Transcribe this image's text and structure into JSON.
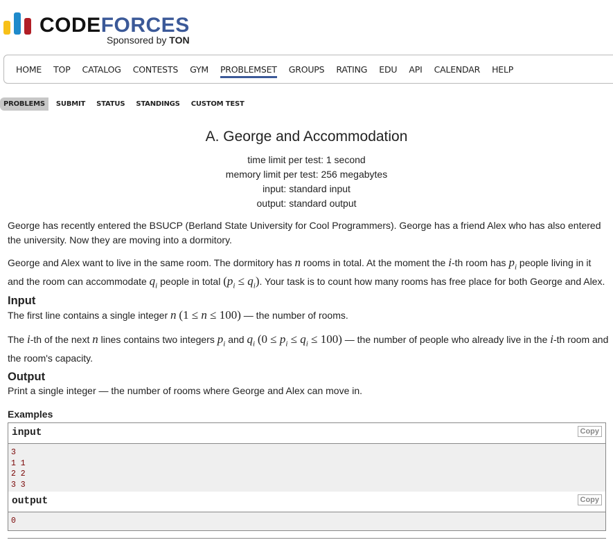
{
  "brand": {
    "code": "CODE",
    "forces": "FORCES",
    "sponsored_by": "Sponsored by",
    "sponsor": "TON",
    "colors": {
      "yellow": "#f7c018",
      "blue": "#1f8acb",
      "red": "#b11e26",
      "navy": "#3b5998"
    }
  },
  "main_menu": [
    "HOME",
    "TOP",
    "CATALOG",
    "CONTESTS",
    "GYM",
    "PROBLEMSET",
    "GROUPS",
    "RATING",
    "EDU",
    "API",
    "CALENDAR",
    "HELP"
  ],
  "sub_menu": [
    "PROBLEMS",
    "SUBMIT",
    "STATUS",
    "STANDINGS",
    "CUSTOM TEST"
  ],
  "problem": {
    "title": "A. George and Accommodation",
    "time_limit": "time limit per test: 1 second",
    "memory_limit": "memory limit per test: 256 megabytes",
    "input": "input: standard input",
    "output": "output: standard output"
  },
  "statement": {
    "p1": "George has recently entered the BSUCP (Berland State University for Cool Programmers). George has a friend Alex who has also entered the university. Now they are moving into a dormitory.",
    "p2_a": "George and Alex want to live in the same room. The dormitory has",
    "p2_b": "rooms in total. At the moment the",
    "p2_c": "-th room has",
    "p2_d": "people living in it and the room can accommodate",
    "p2_e": "people in total",
    "p2_f": ". Your task is to count how many rooms has free place for both George and Alex.",
    "input_title": "Input",
    "in1_a": "The first line contains a single integer",
    "in1_b": "— the number of rooms.",
    "in2_a": "The",
    "in2_b": "-th of the next",
    "in2_c": "lines contains two integers",
    "in2_d": "and",
    "in2_e": "— the number of people who already live in the",
    "in2_f": "-th room and the room's capacity.",
    "output_title": "Output",
    "out1": "Print a single integer — the number of rooms where George and Alex can move in."
  },
  "examples": {
    "title": "Examples",
    "input_label": "input",
    "output_label": "output",
    "copy_label": "Copy",
    "input_text": "3\n1 1\n2 2\n3 3",
    "output_text": "0"
  }
}
